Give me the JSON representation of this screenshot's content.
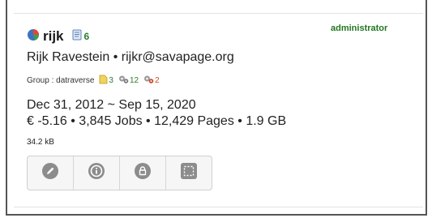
{
  "user": {
    "role": "administrator",
    "id": "rijk",
    "doc_count": "6",
    "full_name": "Rijk Ravestein",
    "separator": "•",
    "email": "rijkr@savapage.org",
    "group_label": "Group : datraverse",
    "stats": [
      {
        "icon": "badge-icon",
        "value": "3",
        "color": "#2e7d2e"
      },
      {
        "icon": "gears-icon",
        "value": "12",
        "color": "#2e7d2e"
      },
      {
        "icon": "gears-warning-icon",
        "value": "2",
        "color": "#d04a2a"
      }
    ],
    "dates": "Dec 31, 2012 ~ Sep 15, 2020",
    "totals": "€ -5.16 • 3,845 Jobs • 12,429 Pages • 1.9 GB",
    "size": "34.2 kB"
  },
  "actions": [
    {
      "name": "edit-button",
      "icon": "pencil-icon"
    },
    {
      "name": "info-button",
      "icon": "info-icon"
    },
    {
      "name": "lock-button",
      "icon": "lock-icon"
    },
    {
      "name": "dashed-square-button",
      "icon": "dashed-square-icon"
    }
  ]
}
